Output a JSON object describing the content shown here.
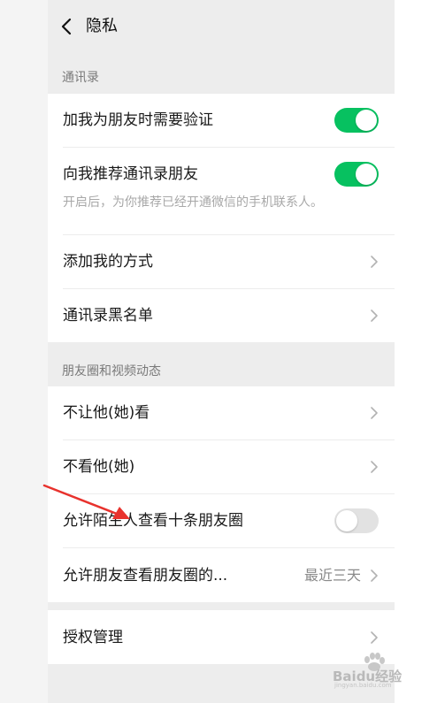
{
  "nav": {
    "title": "隐私",
    "back_icon": "chevron-left-icon"
  },
  "sections": {
    "contacts": {
      "header": "通讯录",
      "items": [
        {
          "label": "加我为朋友时需要验证",
          "control": "toggle",
          "on": true
        },
        {
          "label": "向我推荐通讯录朋友",
          "sublabel": "开启后，为你推荐已经开通微信的手机联系人。",
          "control": "toggle",
          "on": true
        },
        {
          "label": "添加我的方式",
          "control": "chevron"
        },
        {
          "label": "通讯录黑名单",
          "control": "chevron"
        }
      ]
    },
    "moments": {
      "header": "朋友圈和视频动态",
      "items": [
        {
          "label": "不让他(她)看",
          "control": "chevron"
        },
        {
          "label": "不看他(她)",
          "control": "chevron"
        },
        {
          "label": "允许陌生人查看十条朋友圈",
          "control": "toggle",
          "on": false
        },
        {
          "label": "允许朋友查看朋友圈的...",
          "value": "最近三天",
          "control": "chevron"
        }
      ]
    },
    "auth": {
      "items": [
        {
          "label": "授权管理",
          "control": "chevron"
        }
      ]
    }
  },
  "colors": {
    "toggle_on": "#07c160",
    "toggle_off": "#e2e2e2",
    "annotation_arrow": "#e8322d"
  },
  "watermark": {
    "text": "Baidu经验",
    "sub": "jingyan.baidu.com"
  }
}
